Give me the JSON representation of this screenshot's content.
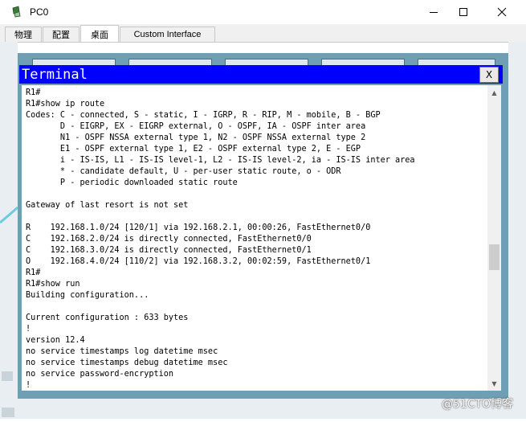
{
  "window": {
    "title": "PC0",
    "icon": "pc-icon",
    "controls": [
      "minimize",
      "maximize",
      "close"
    ]
  },
  "tabs": [
    {
      "label": "物理",
      "active": false
    },
    {
      "label": "配置",
      "active": false
    },
    {
      "label": "桌面",
      "active": true
    },
    {
      "label": "Custom Interface",
      "active": false
    }
  ],
  "terminal": {
    "title": "Terminal",
    "close_label": "X",
    "lines": [
      "R1#",
      "R1#show ip route",
      "Codes: C - connected, S - static, I - IGRP, R - RIP, M - mobile, B - BGP",
      "       D - EIGRP, EX - EIGRP external, O - OSPF, IA - OSPF inter area",
      "       N1 - OSPF NSSA external type 1, N2 - OSPF NSSA external type 2",
      "       E1 - OSPF external type 1, E2 - OSPF external type 2, E - EGP",
      "       i - IS-IS, L1 - IS-IS level-1, L2 - IS-IS level-2, ia - IS-IS inter area",
      "       * - candidate default, U - per-user static route, o - ODR",
      "       P - periodic downloaded static route",
      "",
      "Gateway of last resort is not set",
      "",
      "R    192.168.1.0/24 [120/1] via 192.168.2.1, 00:00:26, FastEthernet0/0",
      "C    192.168.2.0/24 is directly connected, FastEthernet0/0",
      "C    192.168.3.0/24 is directly connected, FastEthernet0/1",
      "O    192.168.4.0/24 [110/2] via 192.168.3.2, 00:02:59, FastEthernet0/1",
      "R1#",
      "R1#show run",
      "Building configuration...",
      "",
      "Current configuration : 633 bytes",
      "!",
      "version 12.4",
      "no service timestamps log datetime msec",
      "no service timestamps debug datetime msec",
      "no service password-encryption",
      "!"
    ]
  },
  "watermark": "@51CTO博客"
}
